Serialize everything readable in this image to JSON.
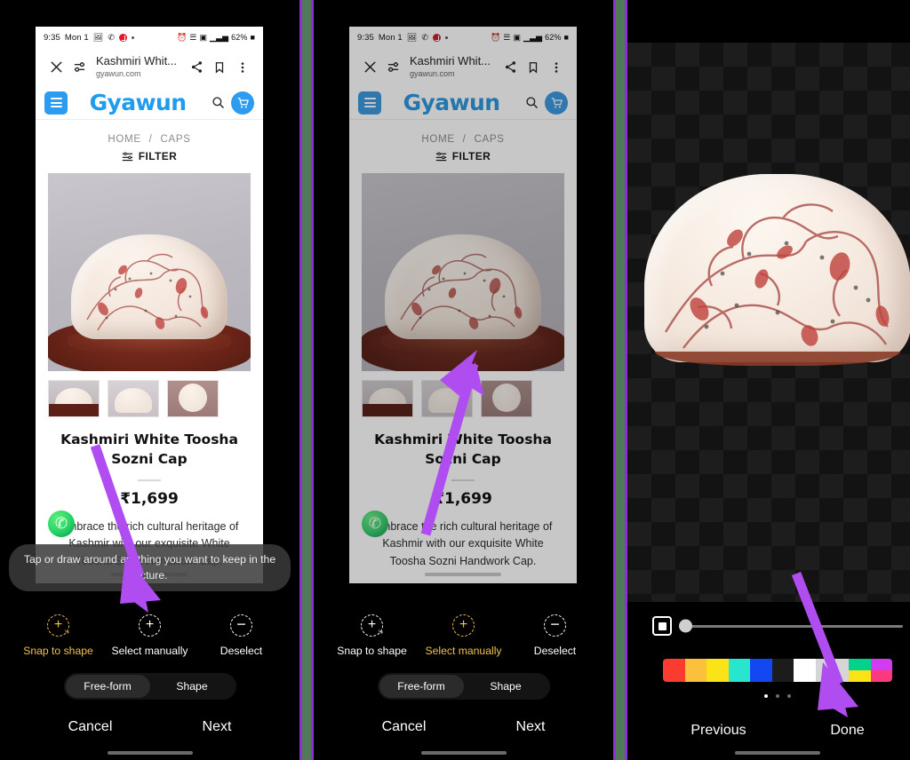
{
  "panels": [
    {
      "id": "panel-1",
      "status_bar": {
        "time": "9:35",
        "date": "Mon 1",
        "battery": "62%"
      },
      "browser": {
        "title": "Kashmiri Whit...",
        "url": "gyawun.com"
      },
      "site": {
        "brand": "Gyawun"
      },
      "breadcrumb": {
        "home": "HOME",
        "separator": "/",
        "current": "CAPS"
      },
      "filter_label": "FILTER",
      "product": {
        "title": "Kashmiri White Toosha Sozni Cap",
        "price": "₹1,699",
        "description": "Embrace the rich cultural heritage of Kashmir with our exquisite White Toosha Sozni Handwork Cap."
      },
      "toast": "Tap or draw around anything you want to keep in the picture.",
      "tools": [
        {
          "label": "Snap to shape",
          "icon": "snap-to-shape-icon",
          "active": true
        },
        {
          "label": "Select manually",
          "icon": "select-manually-icon",
          "active": false
        },
        {
          "label": "Deselect",
          "icon": "deselect-icon",
          "active": false
        }
      ],
      "segment": [
        {
          "label": "Free-form",
          "active": true
        },
        {
          "label": "Shape",
          "active": false
        }
      ],
      "actions": {
        "left": "Cancel",
        "right": "Next"
      }
    },
    {
      "id": "panel-2",
      "status_bar": {
        "time": "9:35",
        "date": "Mon 1",
        "battery": "62%"
      },
      "browser": {
        "title": "Kashmiri Whit...",
        "url": "gyawun.com"
      },
      "site": {
        "brand": "Gyawun"
      },
      "breadcrumb": {
        "home": "HOME",
        "separator": "/",
        "current": "CAPS"
      },
      "filter_label": "FILTER",
      "product": {
        "title": "Kashmiri White Toosha Sozni Cap",
        "price": "₹1,699",
        "description": "Embrace the rich cultural heritage of Kashmir with our exquisite White Toosha Sozni Handwork Cap."
      },
      "tools": [
        {
          "label": "Snap to shape",
          "icon": "snap-to-shape-icon",
          "active": false
        },
        {
          "label": "Select manually",
          "icon": "select-manually-icon",
          "active": true
        },
        {
          "label": "Deselect",
          "icon": "deselect-icon",
          "active": false
        }
      ],
      "segment": [
        {
          "label": "Free-form",
          "active": true
        },
        {
          "label": "Shape",
          "active": false
        }
      ],
      "actions": {
        "left": "Cancel",
        "right": "Next"
      }
    },
    {
      "id": "panel-3",
      "actions": {
        "left": "Previous",
        "right": "Done"
      },
      "swatches": [
        {
          "name": "red",
          "color": "#f93b30"
        },
        {
          "name": "amber",
          "color": "#fbc13c"
        },
        {
          "name": "yellow",
          "color": "#fae317"
        },
        {
          "name": "turquoise",
          "color": "#27e6cd"
        },
        {
          "name": "blue",
          "color": "#1348f0"
        },
        {
          "name": "black",
          "color": "#1c1c1c"
        },
        {
          "name": "white",
          "color": "#ffffff"
        },
        {
          "name": "eyedropper",
          "color": "#d6d6d6",
          "glyph": "✒"
        },
        {
          "name": "green-yellow",
          "color": "#03d28d",
          "color2": "#fae317"
        },
        {
          "name": "magenta-pink",
          "color": "#d23cf0",
          "color2": "#fb3a7e"
        }
      ],
      "page_dots": [
        true,
        false,
        false
      ],
      "slider_value": 0
    }
  ],
  "colors": {
    "accent_yellow": "#f2c14a",
    "brand_blue": "#1f9ced",
    "arrow_purple": "#b04df0",
    "separator_purple": "#8f2fd6",
    "separator_green": "#4f7a55"
  },
  "icons": {
    "close": "✕",
    "tune": "tune-icon",
    "share": "share-icon",
    "bookmark": "☐",
    "more": "⋮",
    "search": "search-icon",
    "cart": "cart-icon",
    "filter": "filter-icon",
    "whatsapp": "whatsapp-icon"
  }
}
